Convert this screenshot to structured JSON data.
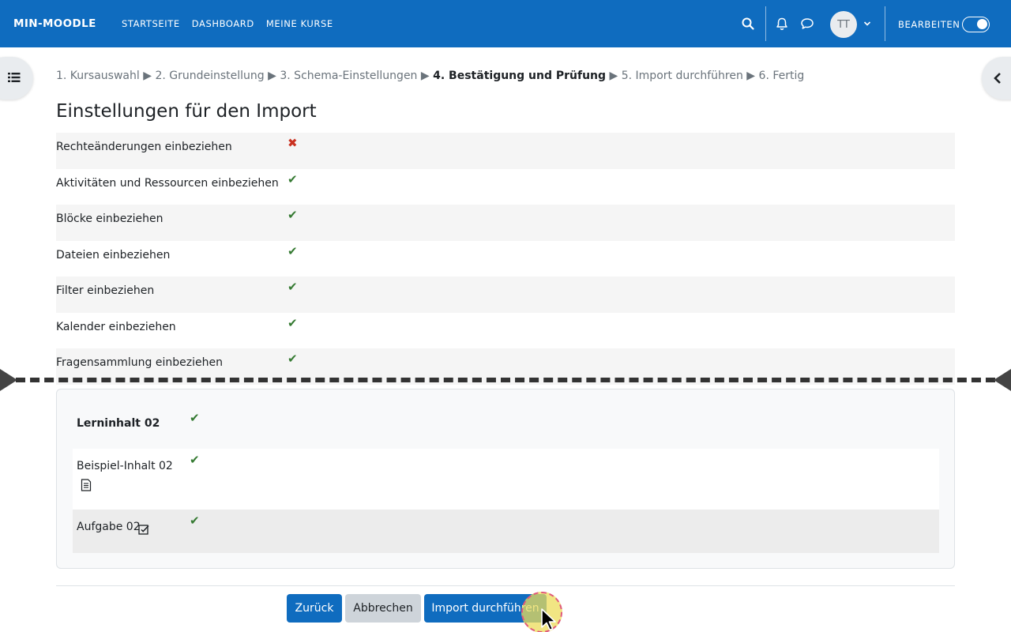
{
  "navbar": {
    "brand": "MIN-MOODLE",
    "links": [
      "STARTSEITE",
      "DASHBOARD",
      "MEINE KURSE"
    ],
    "avatar_initials": "TT",
    "edit_label": "BEARBEITEN",
    "edit_mode_on": true
  },
  "steps": {
    "s1": "1. Kursauswahl",
    "s2": "2. Grundeinstellung",
    "s3": "3. Schema-Einstellungen",
    "s4": "4. Bestätigung und Prüfung",
    "s5": "5. Import durchführen",
    "s6": "6. Fertig",
    "separator": "▶"
  },
  "page_title": "Einstellungen für den Import",
  "settings": [
    {
      "label": "Rechteänderungen einbeziehen",
      "status": "✖"
    },
    {
      "label": "Aktivitäten und Ressourcen einbeziehen",
      "status": "✔"
    },
    {
      "label": "Blöcke einbeziehen",
      "status": "✔"
    },
    {
      "label": "Dateien einbeziehen",
      "status": "✔"
    },
    {
      "label": "Filter einbeziehen",
      "status": "✔"
    },
    {
      "label": "Kalender einbeziehen",
      "status": "✔"
    },
    {
      "label": "Fragensammlung einbeziehen",
      "status": "✔"
    }
  ],
  "section": {
    "title": "Lerninhalt 02",
    "title_status": "✔",
    "activities": [
      {
        "label": "Beispiel-Inhalt 02",
        "icon": "page-icon",
        "status": "✔"
      },
      {
        "label": "Aufgabe 02",
        "icon": "assignment-icon",
        "status": "✔"
      }
    ]
  },
  "buttons": {
    "back": "Zurück",
    "cancel": "Abbrechen",
    "import": "Import durchführen"
  },
  "colors": {
    "brand": "#0f6cbf",
    "ok": "#357a32",
    "bad": "#ca3120",
    "secondary": "#ced4da"
  }
}
